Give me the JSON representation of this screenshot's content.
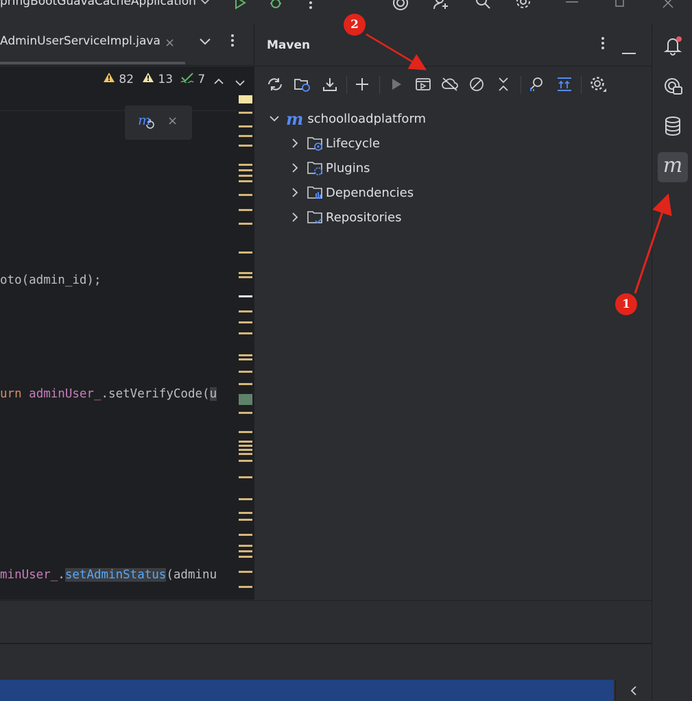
{
  "toolbar": {
    "run_config": "pringBootGuavaCacheApplication"
  },
  "editor": {
    "file_tab": "AdminUserServiceImpl.java",
    "close_glyph": "×",
    "inspections": {
      "warnings": "82",
      "weak_warnings": "13",
      "ok": "7"
    },
    "code_lines": [
      {
        "a": "oto(admin_id);"
      },
      {
        "kw": "urn ",
        "var": "adminUser_",
        "rest": ".setVerifyCode(",
        "tail": "u"
      },
      {
        "var": "minUser_",
        "dot": ".",
        "method": "setAdminStatus",
        "rest": "(admin",
        "tail": "u"
      }
    ]
  },
  "maven": {
    "title": "Maven",
    "project": "schoolloadplatform",
    "nodes": [
      "Lifecycle",
      "Plugins",
      "Dependencies",
      "Repositories"
    ]
  },
  "annotations": {
    "badge_1": "1",
    "badge_2": "2"
  },
  "colors": {
    "accent": "#548af7",
    "badge": "#e1251b",
    "warning": "#f2c55c",
    "ok": "#5fb865"
  }
}
